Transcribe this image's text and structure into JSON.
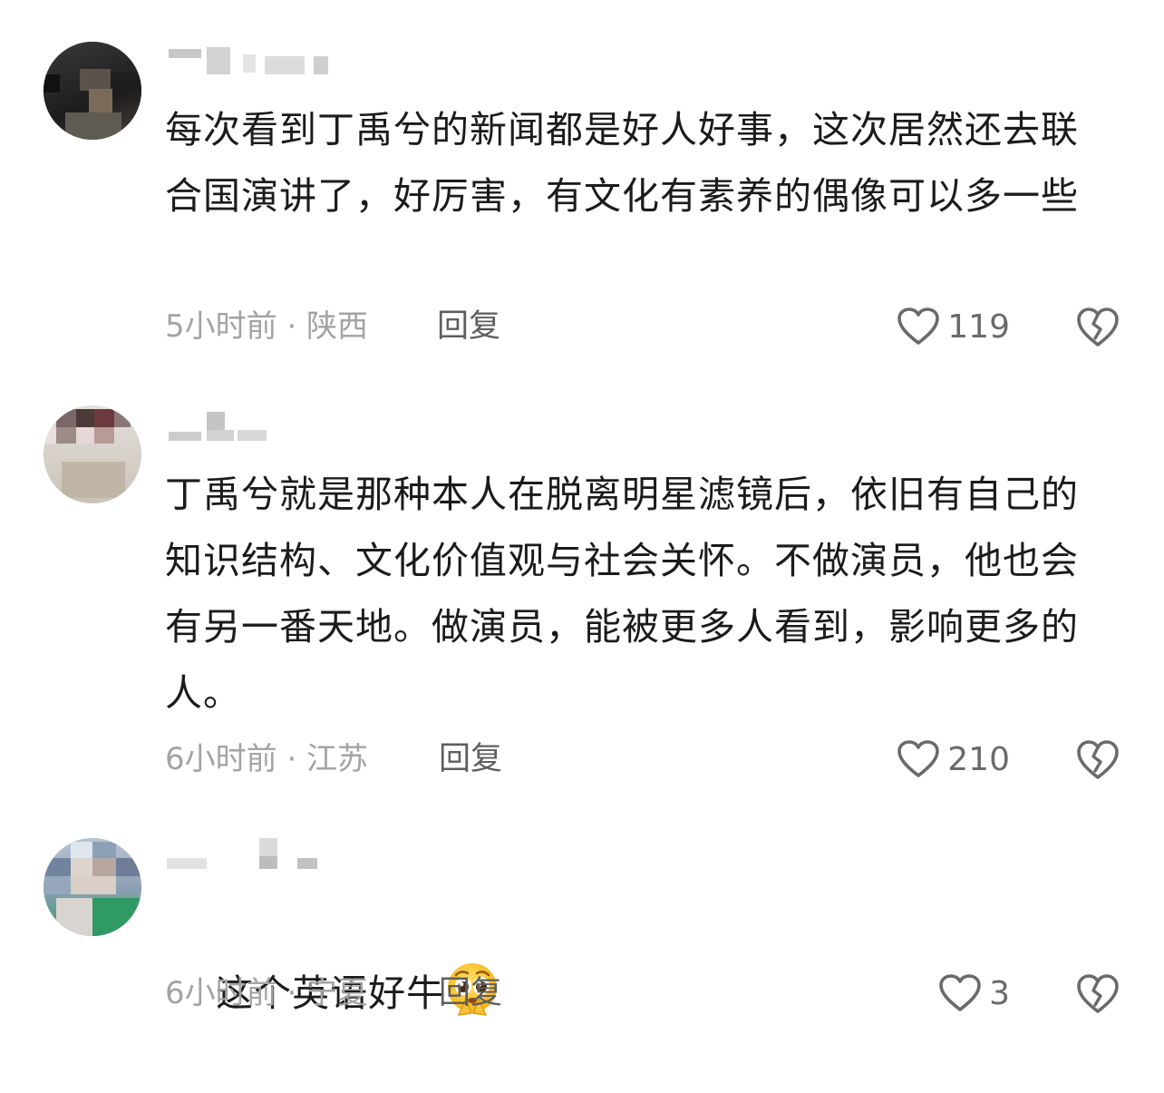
{
  "comments": [
    {
      "text": "每次看到丁禹兮的新闻都是好人好事，这次居然还去联合国演讲了，好厉害，有文化有素养的偶像可以多一些",
      "time_location": "5小时前 · 陕西",
      "reply_label": "回复",
      "like_count": "119",
      "like_icon": "heart-outline-icon",
      "dislike_icon": "broken-heart-icon"
    },
    {
      "text": "丁禹兮就是那种本人在脱离明星滤镜后，依旧有自己的知识结构、文化价值观与社会关怀。不做演员，他也会有另一番天地。做演员，能被更多人看到，影响更多的人。",
      "time_location": "6小时前 · 江苏",
      "reply_label": "回复",
      "like_count": "210",
      "like_icon": "heart-outline-icon",
      "dislike_icon": "broken-heart-icon"
    },
    {
      "text": "这个英语好牛",
      "emoji": "pleading-face-emoji",
      "time_location": "6小时前 · 宁夏",
      "reply_label": "回复",
      "like_count": "3",
      "like_icon": "heart-outline-icon",
      "dislike_icon": "broken-heart-icon"
    }
  ],
  "colors": {
    "text": "#1b1b1b",
    "meta": "#a3a3a3",
    "reply": "#5e5e5e",
    "icon": "#6a6a6a"
  }
}
